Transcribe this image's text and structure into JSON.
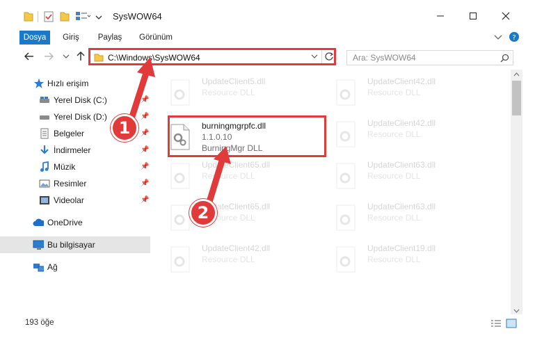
{
  "window": {
    "title": "SysWOW64"
  },
  "ribbon": {
    "tabs": [
      "Dosya",
      "Giriş",
      "Paylaş",
      "Görünüm"
    ]
  },
  "address": {
    "path": "C:\\Windows\\SysWOW64",
    "search_placeholder": "Ara: SysWOW64"
  },
  "sidebar": {
    "quick_access": "Hızlı erişim",
    "items": [
      {
        "label": "Yerel Disk (C:)",
        "icon": "drive-icon",
        "pinned": true
      },
      {
        "label": "Yerel Disk (D:)",
        "icon": "drive-icon",
        "pinned": true
      },
      {
        "label": "Belgeler",
        "icon": "documents-icon",
        "pinned": true
      },
      {
        "label": "İndirmeler",
        "icon": "download-icon",
        "pinned": true
      },
      {
        "label": "Müzik",
        "icon": "music-icon",
        "pinned": true
      },
      {
        "label": "Resimler",
        "icon": "pictures-icon",
        "pinned": true
      },
      {
        "label": "Videolar",
        "icon": "videos-icon",
        "pinned": true
      }
    ],
    "onedrive": "OneDrive",
    "this_pc": "Bu bilgisayar",
    "network": "Ağ"
  },
  "files": {
    "highlighted": {
      "name": "burningmgrpfc.dll",
      "version": "1.1.0.10",
      "description": "BurningMgr DLL"
    },
    "faded": [
      {
        "name": "UpdateClient5.dll",
        "desc": "Resource DLL"
      },
      {
        "name": "UpdateClient42.dll",
        "desc": "Resource DLL"
      },
      {
        "name": "UpdateClient42.dll",
        "desc": "Resource DLL"
      },
      {
        "name": "UpdateClient65.dll",
        "desc": "Resource DLL"
      },
      {
        "name": "UpdateClient63.dll",
        "desc": "Resource DLL"
      },
      {
        "name": "UpdateClient65.dll",
        "desc": "Resource DLL"
      },
      {
        "name": "UpdateClient63.dll",
        "desc": "Resource DLL"
      },
      {
        "name": "UpdateClient42.dll",
        "desc": "Resource DLL"
      },
      {
        "name": "UpdateClient19.dll",
        "desc": "Resource DLL"
      }
    ]
  },
  "status": {
    "count": "193 öğe"
  },
  "annotations": {
    "step1": "1",
    "step2": "2"
  },
  "colors": {
    "accent": "#1979ca",
    "highlight": "#e03a3a"
  }
}
